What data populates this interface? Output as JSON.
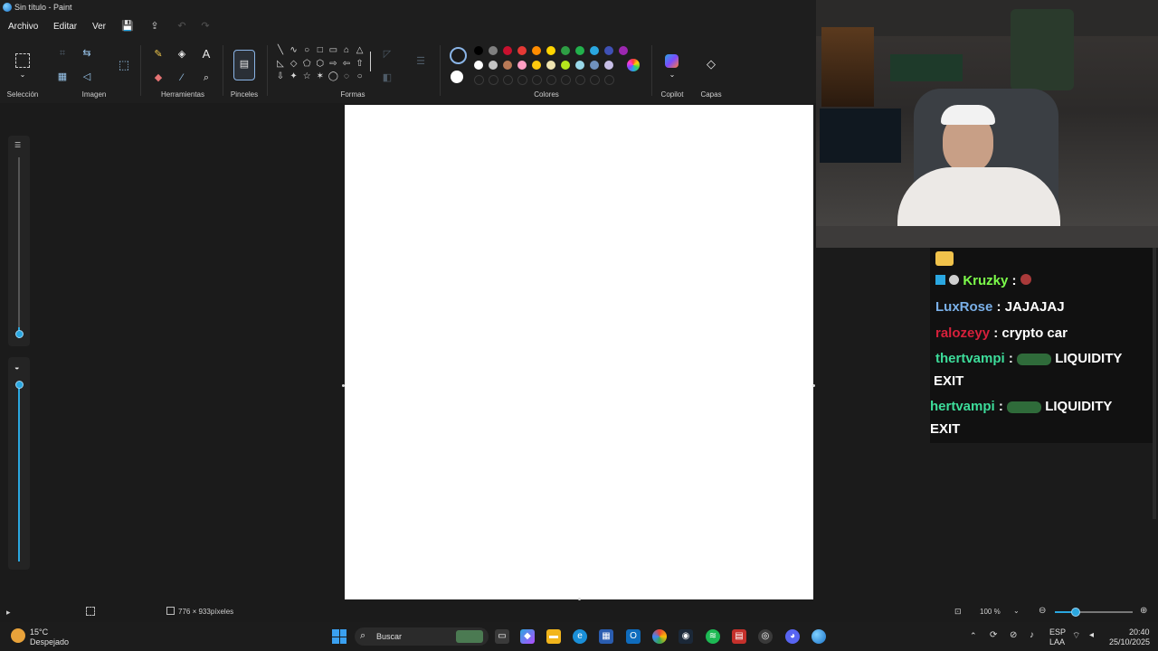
{
  "window": {
    "title": "Sin título - Paint"
  },
  "menu": {
    "file": "Archivo",
    "edit": "Editar",
    "view": "Ver"
  },
  "ribbon": {
    "groups": {
      "selection": "Selección",
      "image": "Imagen",
      "tools": "Herramientas",
      "brushes": "Pinceles",
      "shapes": "Formas",
      "colors": "Colores",
      "copilot": "Copilot",
      "layers": "Capas"
    },
    "text_tool_glyph": "A",
    "palette": {
      "row1": [
        "#000000",
        "#7f7f7f",
        "#c8102e",
        "#e53935",
        "#ff8c00",
        "#ffd400",
        "#2e9e44",
        "#22b14c",
        "#2aa7e0",
        "#3f51b5",
        "#9c27b0"
      ],
      "row2": [
        "#ffffff",
        "#c3c3c3",
        "#b97a57",
        "#ff9ec4",
        "#ffc90e",
        "#efe4b0",
        "#b5e61d",
        "#99d9ea",
        "#7092be",
        "#c8bfe7"
      ],
      "primary": "#1a1a1a",
      "secondary": "#ffffff"
    }
  },
  "status": {
    "canvas_size": "776 × 933píxeles",
    "zoom": "100 %",
    "zoom_fraction": 0.25
  },
  "chat": {
    "messages": [
      {
        "user": "Kruzky",
        "sep": ":",
        "text": "",
        "color": "#7cfc4a"
      },
      {
        "user": "LuxRose",
        "sep": ":",
        "text": "JAJAJAJ",
        "color": "#7ab0e8"
      },
      {
        "user": "ralozeyy",
        "sep": ":",
        "text": "crypto car",
        "color": "#d6203b"
      },
      {
        "user": "thertvampi",
        "sep": ":",
        "text": "LIQUIDITY",
        "cont": "EXIT",
        "color": "#3ddc9a"
      },
      {
        "user": "hertvampi",
        "sep": ":",
        "text": "LIQUIDITY",
        "cont": "EXIT",
        "color": "#3ddc9a"
      }
    ]
  },
  "taskbar": {
    "weather_temp": "15°C",
    "weather_desc": "Despejado",
    "search_placeholder": "Buscar",
    "lang": "ESP",
    "lang2": "LAA",
    "time": "20:40",
    "date": "25/10/2025"
  }
}
